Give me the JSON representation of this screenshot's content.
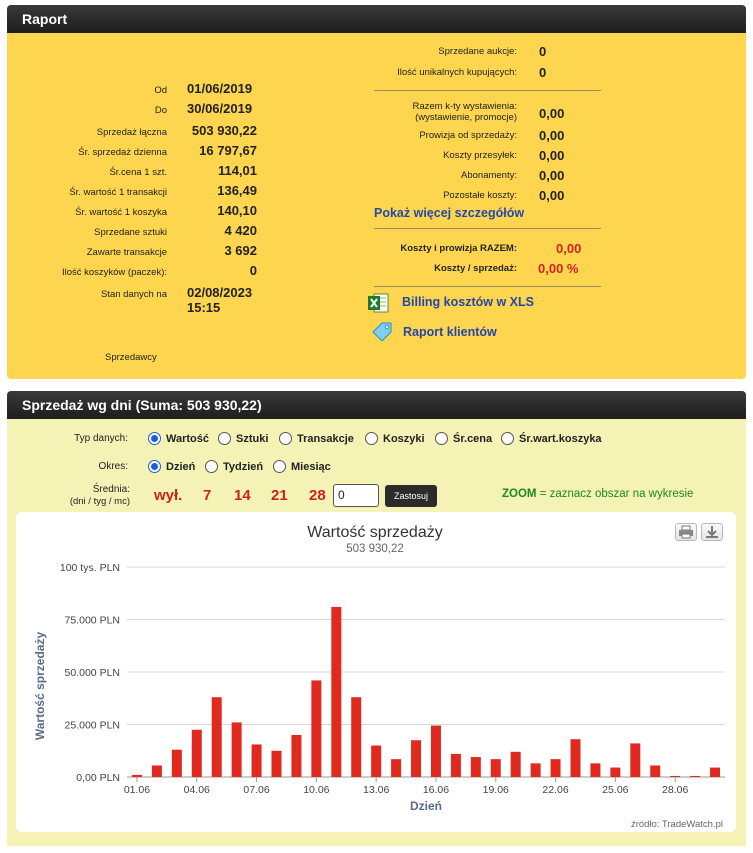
{
  "report": {
    "title": "Raport",
    "left_rows": [
      {
        "label": "Od",
        "value": "01/06/2019"
      },
      {
        "label": "Do",
        "value": "30/06/2019"
      },
      {
        "label": "Sprzedaż łączna",
        "value": "503 930,22"
      },
      {
        "label": "Śr. sprzedaż dzienna",
        "value": "16 797,67"
      },
      {
        "label": "Śr.cena 1 szt.",
        "value": "114,01"
      },
      {
        "label": "Śr. wartość 1 transakcji",
        "value": "136,49"
      },
      {
        "label": "Śr. wartość 1 koszyka",
        "value": "140,10"
      },
      {
        "label": "Sprzedane sztuki",
        "value": "4 420"
      },
      {
        "label": "Zawarte transakcje",
        "value": "3 692"
      },
      {
        "label": "Ilość koszyków (paczek):",
        "value": "0"
      },
      {
        "label": "Stan danych na",
        "value": "02/08/2023 15:15"
      }
    ],
    "sellers_label": "Sprzedawcy",
    "right_top": [
      {
        "label": "Sprzedane aukcje:",
        "value": "0"
      },
      {
        "label": "Ilość unikalnych kupujących:",
        "value": "0"
      }
    ],
    "costs": {
      "listing_label_1": "Razem k-ty wystawienia:",
      "listing_label_2": "(wystawienie, promocje)",
      "listing_value": "0,00",
      "commission_label": "Prowizja od sprzedaży:",
      "commission_value": "0,00",
      "shipping_label": "Koszty przesyłek:",
      "shipping_value": "0,00",
      "subscription_label": "Abonamenty:",
      "subscription_value": "0,00",
      "other_label": "Pozostałe koszty:",
      "other_value": "0,00",
      "more_link": "Pokaż więcej szczegółów",
      "total_label": "Koszty i prowizja RAZEM:",
      "total_value": "0,00",
      "ratio_label": "Koszty / sprzedaż:",
      "ratio_value": "0,00 %"
    },
    "billing_link": "Billing kosztów w XLS",
    "clients_link": "Raport klientów"
  },
  "sales": {
    "title": "Sprzedaż wg dni (Suma: 503 930,22)",
    "type_label": "Typ danych:",
    "type_options": [
      "Wartość",
      "Sztuki",
      "Transakcje",
      "Koszyki",
      "Śr.cena",
      "Śr.wart.koszyka"
    ],
    "period_label": "Okres:",
    "period_options": [
      "Dzień",
      "Tydzień",
      "Miesiąc"
    ],
    "avg_label_1": "Średnia:",
    "avg_label_2": "(dni / tyg / mc)",
    "avg_options": [
      "wył.",
      "7",
      "14",
      "21",
      "28"
    ],
    "avg_input_value": "0",
    "apply_label": "Zastosuj",
    "zoom_bold": "ZOOM",
    "zoom_text": " = zaznacz obszar na wykresie",
    "source": "źródło: TradeWatch.pl"
  },
  "colors": {
    "header_bg": "#2a2a2a",
    "report_bg": "#fdd54f",
    "sales_bg": "#f5f2b6",
    "bar": "#e02a1f",
    "link": "#2647a6",
    "accent_red": "#d42020",
    "zoom_green": "#1a8a1a"
  },
  "chart_data": {
    "type": "bar",
    "title": "Wartość sprzedaży",
    "subtitle": "503 930,22",
    "xlabel": "Dzień",
    "ylabel": "Wartość sprzedaży",
    "ylim": [
      0,
      100000
    ],
    "y_ticks": [
      0,
      25000,
      50000,
      75000,
      100000
    ],
    "y_tick_labels": [
      "0,00 PLN",
      "25.000 PLN",
      "50.000 PLN",
      "75.000 PLN",
      "100 tys. PLN"
    ],
    "x_tick_labels": [
      "01.06",
      "04.06",
      "07.06",
      "10.06",
      "13.06",
      "16.06",
      "19.06",
      "22.06",
      "25.06",
      "28.06"
    ],
    "categories": [
      "01.06",
      "02.06",
      "03.06",
      "04.06",
      "05.06",
      "06.06",
      "07.06",
      "08.06",
      "09.06",
      "10.06",
      "11.06",
      "12.06",
      "13.06",
      "14.06",
      "15.06",
      "16.06",
      "17.06",
      "18.06",
      "19.06",
      "20.06",
      "21.06",
      "22.06",
      "23.06",
      "24.06",
      "25.06",
      "26.06",
      "27.06",
      "28.06",
      "29.06",
      "30.06"
    ],
    "values": [
      1000,
      5500,
      13000,
      22500,
      38000,
      26000,
      15500,
      12500,
      20000,
      46000,
      81000,
      38000,
      15000,
      8500,
      17500,
      24500,
      11000,
      9500,
      8500,
      12000,
      6500,
      8500,
      18000,
      6500,
      4500,
      16000,
      5500,
      500,
      500,
      4500
    ],
    "grid": true
  }
}
